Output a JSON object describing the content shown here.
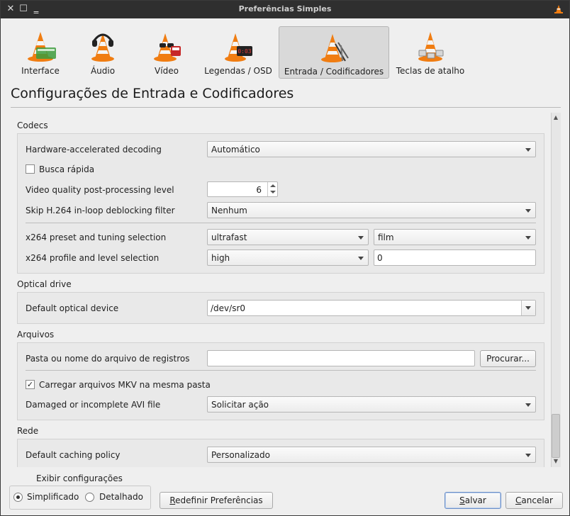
{
  "window": {
    "title": "Preferências Simples"
  },
  "tabs": [
    {
      "label": "Interface",
      "icon": "interface-cone-icon",
      "active": false
    },
    {
      "label": "Áudio",
      "icon": "audio-cone-icon",
      "active": false
    },
    {
      "label": "Vídeo",
      "icon": "video-cone-icon",
      "active": false
    },
    {
      "label": "Legendas / OSD",
      "icon": "subtitles-cone-icon",
      "active": false
    },
    {
      "label": "Entrada / Codificadores",
      "icon": "input-codecs-cone-icon",
      "active": true
    },
    {
      "label": "Teclas de atalho",
      "icon": "hotkeys-cone-icon",
      "active": false
    }
  ],
  "page": {
    "heading": "Configurações de Entrada e Codificadores"
  },
  "codecs": {
    "title": "Codecs",
    "hw_decoding_label": "Hardware-accelerated decoding",
    "hw_decoding_value": "Automático",
    "fast_seek_label": "Busca rápida",
    "fast_seek_checked": false,
    "pp_level_label": "Video quality post-processing level",
    "pp_level_value": "6",
    "skip_h264_label": "Skip H.264 in-loop deblocking filter",
    "skip_h264_value": "Nenhum",
    "x264_preset_label": "x264 preset and tuning selection",
    "x264_preset_value": "ultrafast",
    "x264_tune_value": "film",
    "x264_profile_label": "x264 profile and level selection",
    "x264_profile_value": "high",
    "x264_level_value": "0"
  },
  "optical": {
    "title": "Optical drive",
    "device_label": "Default optical device",
    "device_value": "/dev/sr0"
  },
  "files": {
    "title": "Arquivos",
    "log_label": "Pasta ou nome do arquivo de registros",
    "log_value": "",
    "browse_label": "Procurar...",
    "mkv_label": "Carregar arquivos MKV na mesma pasta",
    "mkv_checked": true,
    "mkv_check_glyph": "✓",
    "avi_label": "Damaged or incomplete AVI file",
    "avi_value": "Solicitar ação"
  },
  "network": {
    "title": "Rede",
    "caching_label": "Default caching policy",
    "caching_value": "Personalizado"
  },
  "footer": {
    "show_settings_label": "Exibir configurações",
    "simple_label": "Simplificado",
    "simple_selected": true,
    "detailed_label": "Detalhado",
    "reset_label_first": "R",
    "reset_label_rest": "edefinir Preferências",
    "save_label_first": "S",
    "save_label_rest": "alvar",
    "cancel_label_first": "C",
    "cancel_label_rest": "ancelar"
  },
  "colors": {
    "cone_orange": "#f07d12",
    "cone_white": "#f5f5f5",
    "titlebar": "#2f2f2f",
    "active_tab": "#d9d9d9"
  }
}
